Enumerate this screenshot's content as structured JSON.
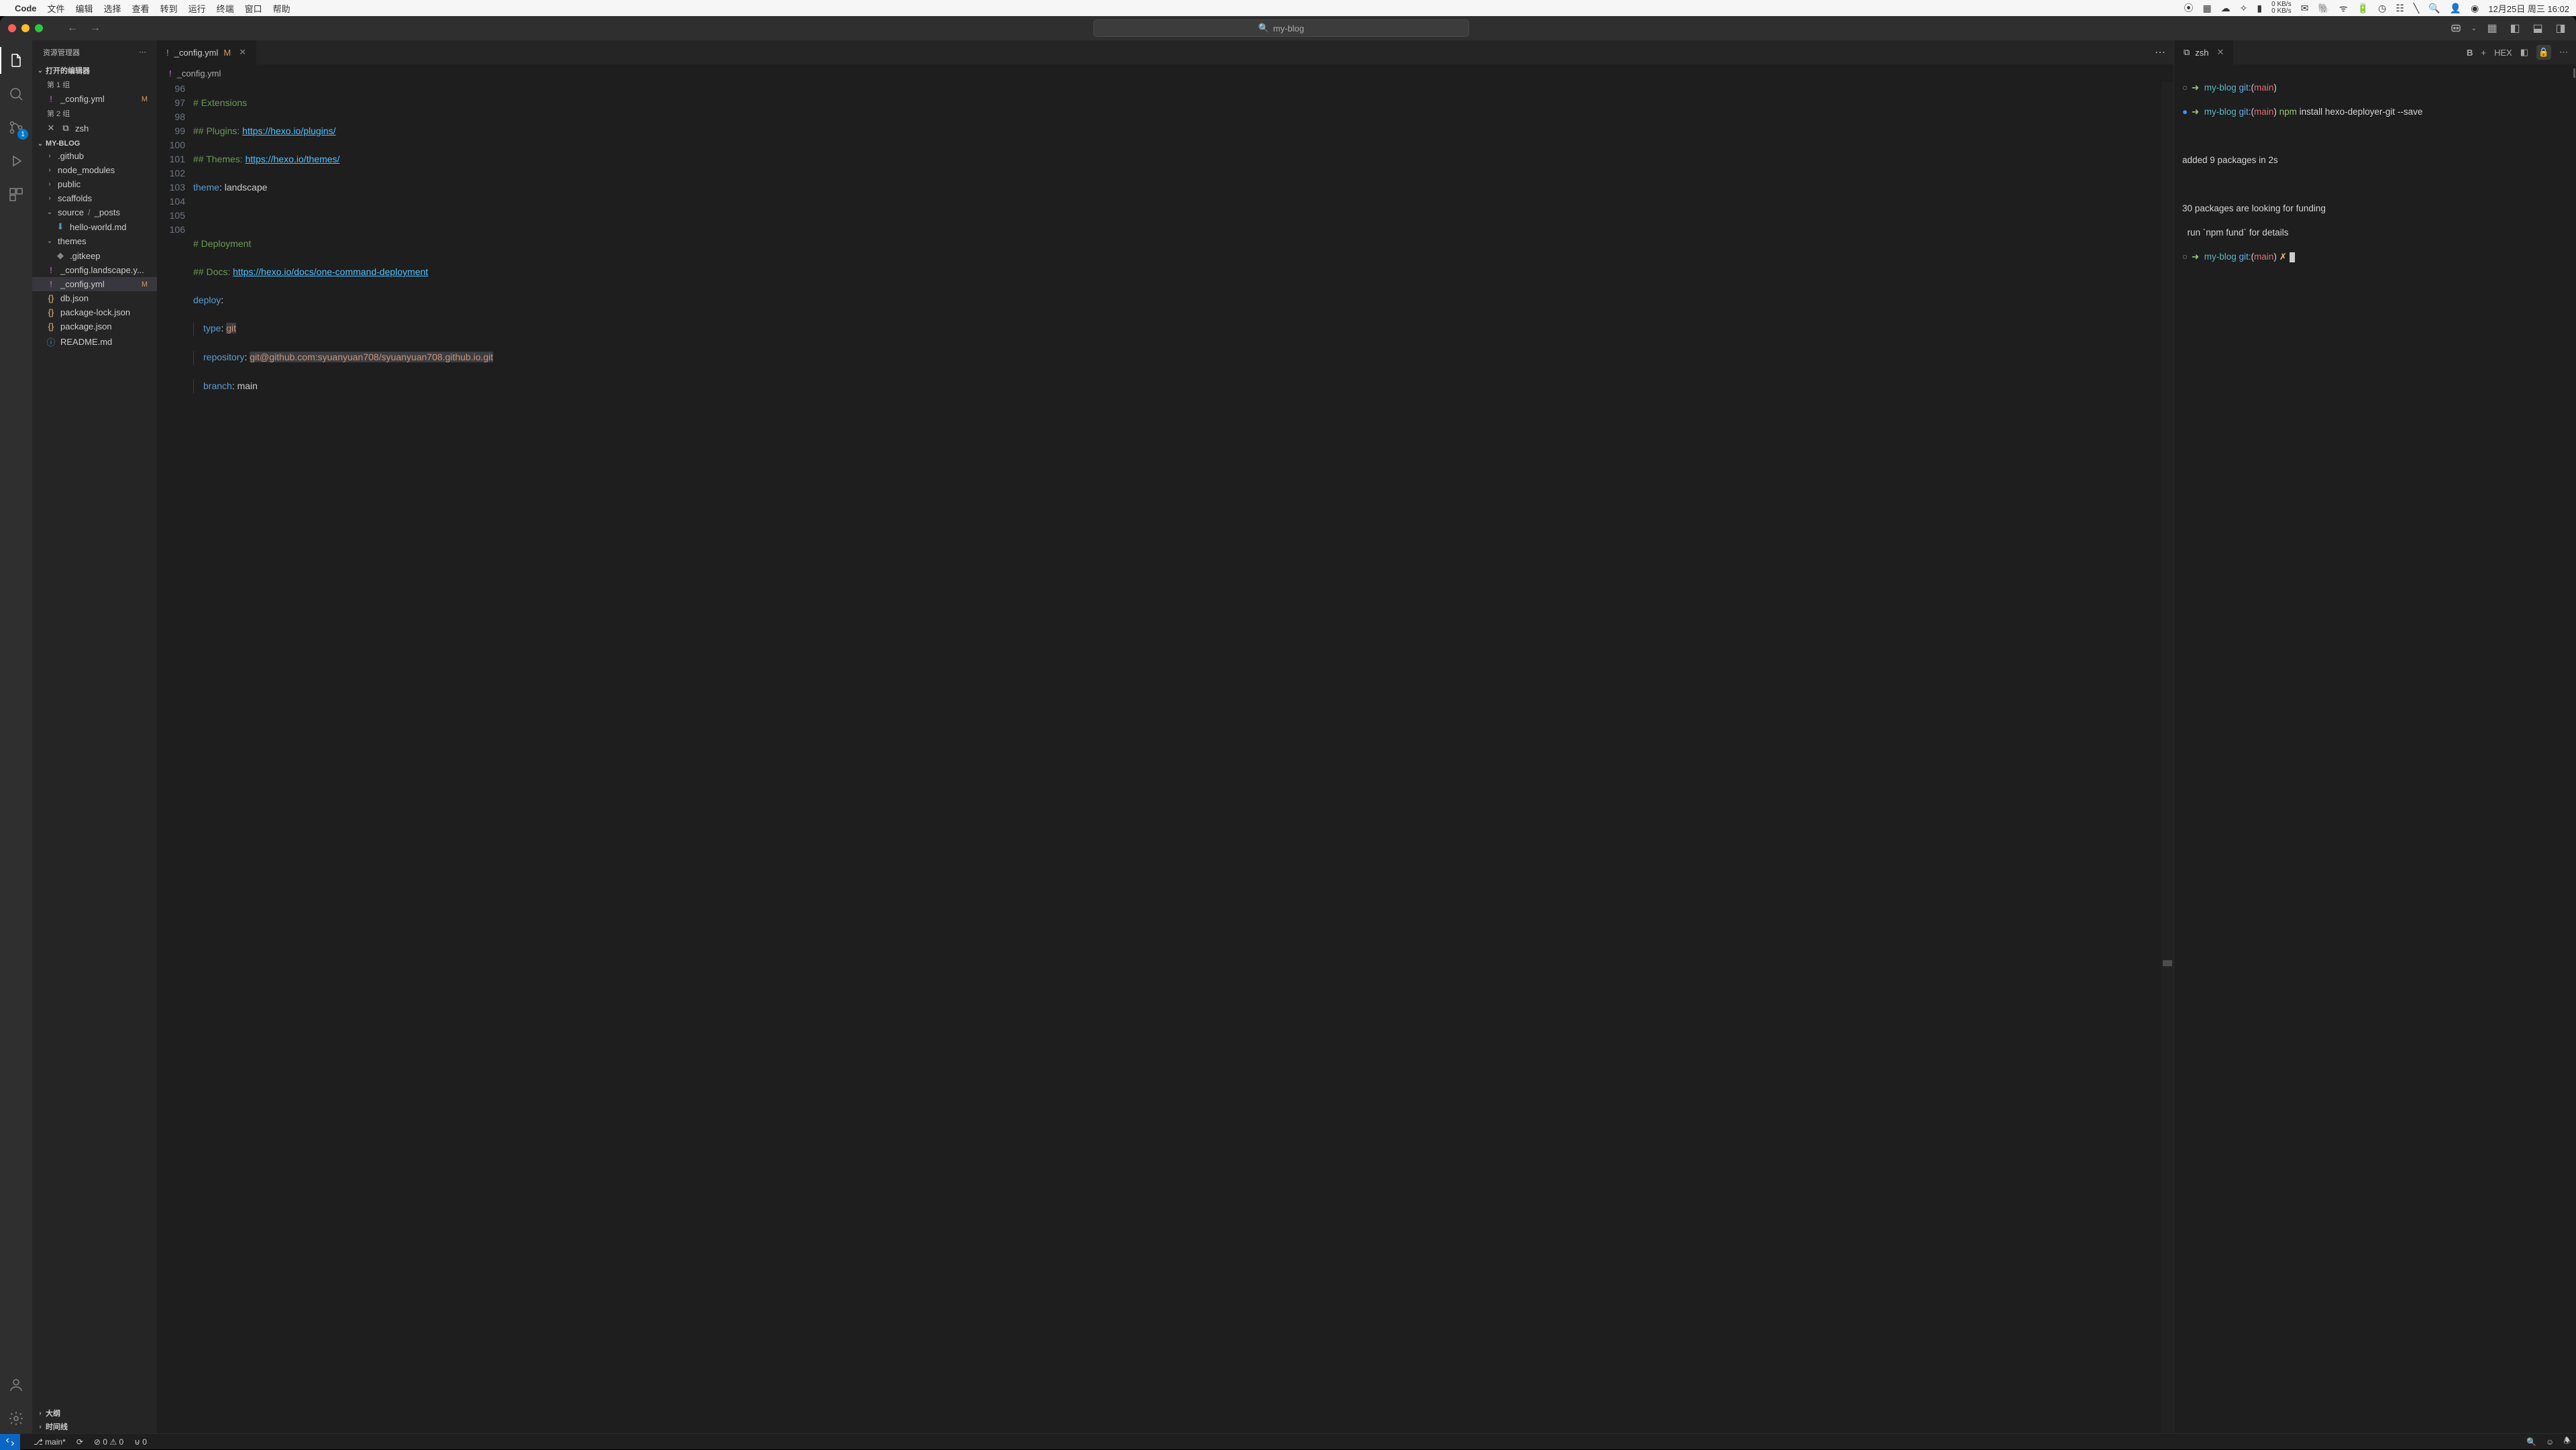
{
  "macos": {
    "appname": "Code",
    "menus": [
      "文件",
      "编辑",
      "选择",
      "查看",
      "转到",
      "运行",
      "终端",
      "窗口",
      "帮助"
    ],
    "date": "12月25日 周三 16:02",
    "netstat": "0 KB/s\n0 KB/s"
  },
  "titlebar": {
    "search": "my-blog"
  },
  "activity": {
    "scm_badge": "1"
  },
  "sidebar": {
    "title": "资源管理器",
    "open_editors": "打开的编辑器",
    "group1": "第 1 组",
    "group2": "第 2 组",
    "editor1_name": "_config.yml",
    "editor1_mod": "M",
    "editor2_name": "zsh",
    "project": "MY-BLOG",
    "tree": {
      "github": ".github",
      "node_modules": "node_modules",
      "public": "public",
      "scaffolds": "scaffolds",
      "source": "source",
      "posts": "_posts",
      "hello": "hello-world.md",
      "themes": "themes",
      "gitkeep": ".gitkeep",
      "config_landscape": "_config.landscape.y...",
      "config": "_config.yml",
      "config_mod": "M",
      "db": "db.json",
      "pkg_lock": "package-lock.json",
      "pkg": "package.json",
      "readme": "README.md"
    },
    "outline": "大纲",
    "timeline": "时间线"
  },
  "editor": {
    "tab_name": "_config.yml",
    "tab_mod": "M",
    "breadcrumb_file": "_config.yml",
    "lines": {
      "l96": "# Extensions",
      "l97a": "## Plugins: ",
      "l97b": "https://hexo.io/plugins/",
      "l98a": "## Themes: ",
      "l98b": "https://hexo.io/themes/",
      "l99k": "theme",
      "l99v": "landscape",
      "l101": "# Deployment",
      "l102a": "## Docs: ",
      "l102b": "https://hexo.io/docs/one-command-deployment",
      "l103k": "deploy",
      "l104k": "type",
      "l104v": "git",
      "l105k": "repository",
      "l105v": "git@github.com:syuanyuan708/syuanyuan708.github.io.git",
      "l106k": "branch",
      "l106v": "main"
    },
    "linenos": [
      "96",
      "97",
      "98",
      "99",
      "100",
      "101",
      "102",
      "103",
      "104",
      "105",
      "106"
    ]
  },
  "terminal": {
    "tab": "zsh",
    "prompt_dir": "my-blog",
    "prompt_git": "git:",
    "prompt_branch": "main",
    "cmd_npm": "npm",
    "cmd_args": "install hexo-deployer-git --save",
    "out1": "added 9 packages in 2s",
    "out2": "30 packages are looking for funding",
    "out3": "  run `npm fund` for details",
    "dirty": "✗",
    "actions": {
      "bold": "B",
      "plus": "+",
      "hex": "HEX"
    }
  },
  "status": {
    "branch": "main*",
    "errors": "0",
    "warnings": "0",
    "ports": "0"
  }
}
